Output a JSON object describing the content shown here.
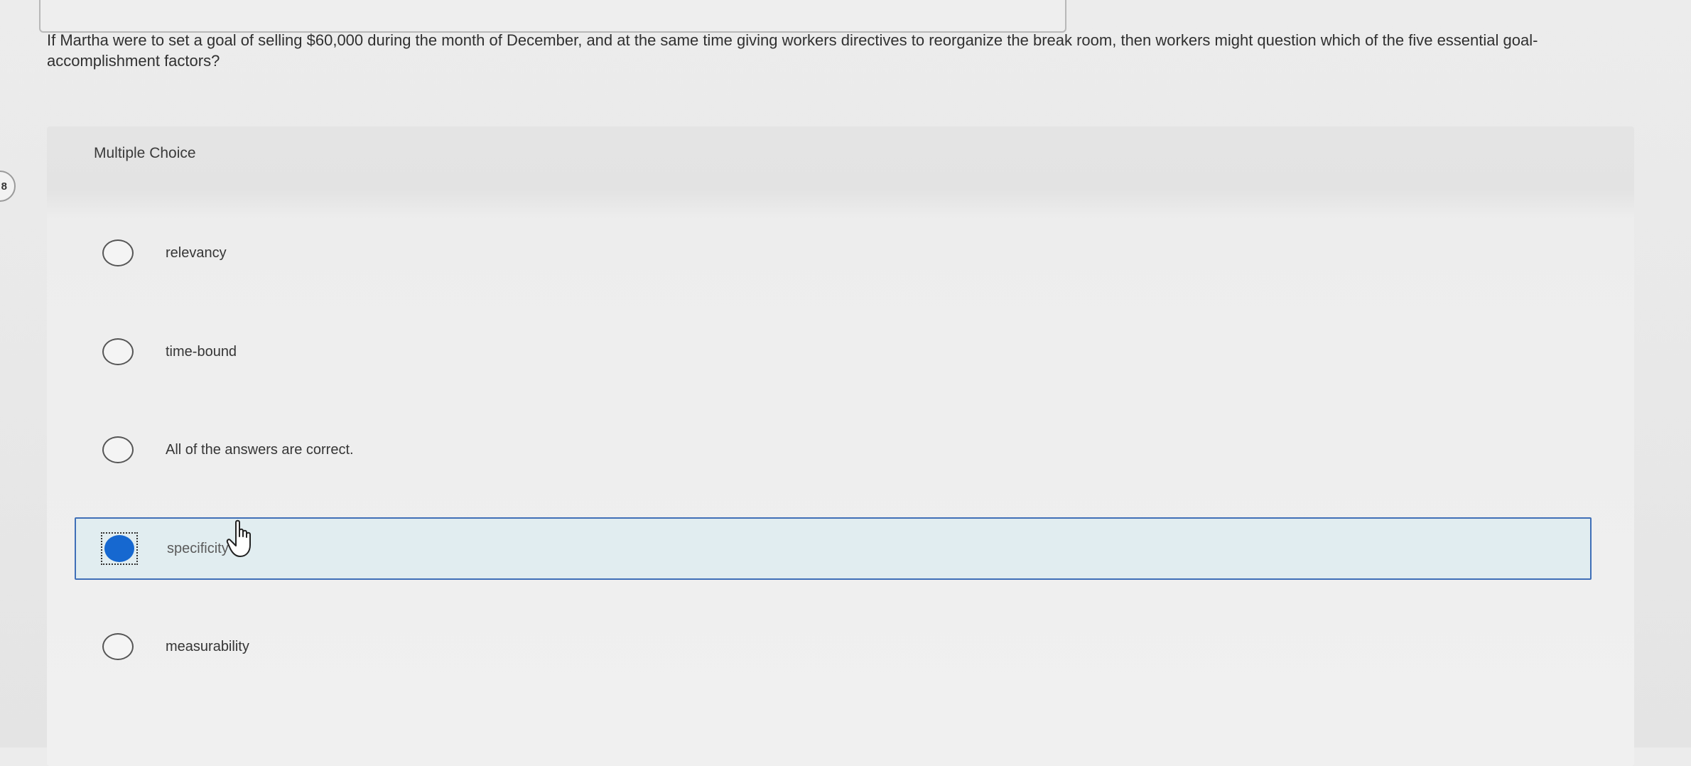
{
  "question": {
    "text": "If Martha were to set a goal of selling $60,000 during the month of December, and at the same time giving workers directives to reorganize the break room, then workers might question which of the five essential goal-accomplishment factors?"
  },
  "side_badge": "8",
  "quiz": {
    "type_label": "Multiple Choice",
    "options": [
      {
        "label": "relevancy",
        "selected": false
      },
      {
        "label": "time-bound",
        "selected": false
      },
      {
        "label": "All of the answers are correct.",
        "selected": false
      },
      {
        "label": "specificity",
        "selected": true
      },
      {
        "label": "measurability",
        "selected": false
      }
    ]
  },
  "colors": {
    "selected_fill": "#1668d0",
    "selected_border": "#3f6fb7",
    "selected_bg": "#e1edf0"
  },
  "icons": {
    "cursor": "hand-pointer-icon"
  }
}
